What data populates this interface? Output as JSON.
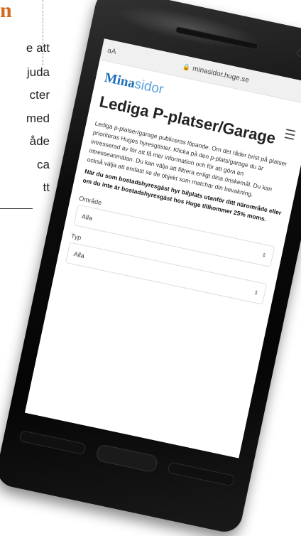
{
  "background": {
    "heading_fragment": "n",
    "text_lines": [
      "e att",
      "juda",
      "cter",
      "med",
      "åde",
      "ca",
      "tt"
    ]
  },
  "browser": {
    "text_size": "aA",
    "url": "minasidor.huge.se",
    "lock_icon": "lock-icon",
    "reload_icon": "reload-icon"
  },
  "brand": {
    "bold": "Mina",
    "light": "sidor"
  },
  "page": {
    "title": "Lediga P-platser/Garage",
    "description": "Lediga p-platser/garage publiceras löpande. Om det råder brist på platser prioriteras Huges hyresgäster. Klicka på den p-plats/garage du är intresserad av för att få mer information och för att göra en intresseanmälan. Du kan välja att filtrera enligt dina önskemål. Du kan också välja att endast se de objekt som matchar din bevakning.",
    "notice": "När du som bostadshyresgäst hyr bilplats utanför ditt närområde eller om du inte är bostadshyresgäst hos Huge tillkommer 25% moms."
  },
  "filters": [
    {
      "label": "Område",
      "value": "Alla"
    },
    {
      "label": "Typ",
      "value": "Alla"
    }
  ],
  "colors": {
    "brand_blue": "#1e6fb8",
    "brand_light": "#5aa1dd",
    "heading_orange": "#d2691e"
  }
}
